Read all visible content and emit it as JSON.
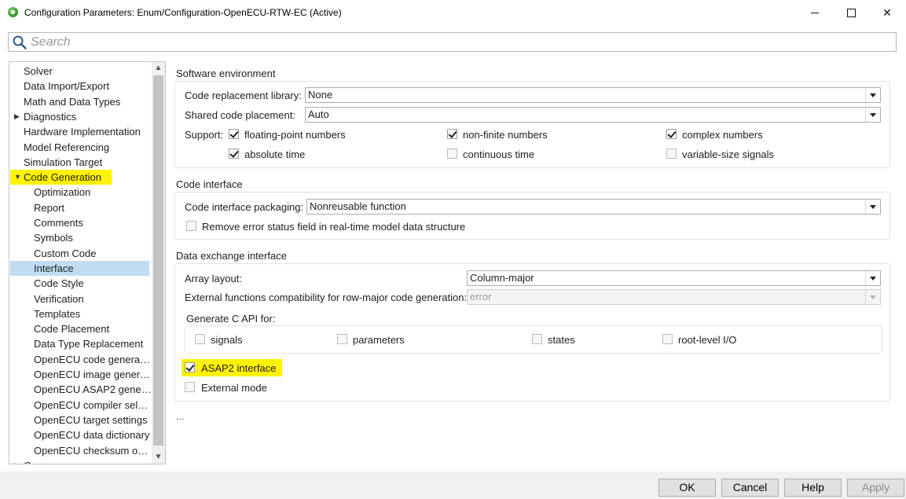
{
  "window": {
    "title": "Configuration Parameters: Enum/Configuration-OpenECU-RTW-EC (Active)",
    "minimize_glyph": "—",
    "close_glyph": "✕"
  },
  "search": {
    "placeholder": "Search",
    "value": ""
  },
  "tree": {
    "items": [
      {
        "label": "Solver",
        "level": 0
      },
      {
        "label": "Data Import/Export",
        "level": 0
      },
      {
        "label": "Math and Data Types",
        "level": 0
      },
      {
        "label": "Diagnostics",
        "level": 0,
        "expander": "collapsed"
      },
      {
        "label": "Hardware Implementation",
        "level": 0
      },
      {
        "label": "Model Referencing",
        "level": 0
      },
      {
        "label": "Simulation Target",
        "level": 0
      },
      {
        "label": "Code Generation",
        "level": 0,
        "expander": "expanded",
        "highlighted": true
      },
      {
        "label": "Optimization",
        "level": 1
      },
      {
        "label": "Report",
        "level": 1
      },
      {
        "label": "Comments",
        "level": 1
      },
      {
        "label": "Symbols",
        "level": 1
      },
      {
        "label": "Custom Code",
        "level": 1
      },
      {
        "label": "Interface",
        "level": 1,
        "selected": true
      },
      {
        "label": "Code Style",
        "level": 1
      },
      {
        "label": "Verification",
        "level": 1
      },
      {
        "label": "Templates",
        "level": 1
      },
      {
        "label": "Code Placement",
        "level": 1
      },
      {
        "label": "Data Type Replacement",
        "level": 1
      },
      {
        "label": "OpenECU code genera…",
        "level": 1
      },
      {
        "label": "OpenECU image gener…",
        "level": 1
      },
      {
        "label": "OpenECU ASAP2 gene…",
        "level": 1
      },
      {
        "label": "OpenECU compiler sel…",
        "level": 1
      },
      {
        "label": "OpenECU target settings",
        "level": 1
      },
      {
        "label": "OpenECU data dictionary",
        "level": 1
      },
      {
        "label": "OpenECU checksum o…",
        "level": 1
      },
      {
        "label": "Coverage",
        "level": 0,
        "expander": "collapsed"
      }
    ]
  },
  "software_env": {
    "title": "Software environment",
    "code_replacement_label": "Code replacement library:",
    "code_replacement_value": "None",
    "shared_code_label": "Shared code placement:",
    "shared_code_value": "Auto",
    "support_label": "Support:",
    "floating_point": {
      "label": "floating-point numbers",
      "checked": true
    },
    "non_finite": {
      "label": "non-finite numbers",
      "checked": true
    },
    "complex": {
      "label": "complex numbers",
      "checked": true
    },
    "absolute_time": {
      "label": "absolute time",
      "checked": true
    },
    "continuous_time": {
      "label": "continuous time",
      "checked": false
    },
    "variable_size": {
      "label": "variable-size signals",
      "checked": false
    }
  },
  "code_interface": {
    "title": "Code interface",
    "packaging_label": "Code interface packaging:",
    "packaging_value": "Nonreusable function",
    "remove_error": {
      "label": "Remove error status field in real-time model data structure",
      "checked": false
    }
  },
  "data_exchange": {
    "title": "Data exchange interface",
    "array_layout_label": "Array layout:",
    "array_layout_value": "Column-major",
    "ext_func_label": "External functions compatibility for row-major code generation:",
    "ext_func_value": "error",
    "c_api_label": "Generate C API for:",
    "signals": {
      "label": "signals",
      "checked": false
    },
    "parameters": {
      "label": "parameters",
      "checked": false
    },
    "states": {
      "label": "states",
      "checked": false
    },
    "root_io": {
      "label": "root-level I/O",
      "checked": false
    },
    "asap2": {
      "label": "ASAP2 interface",
      "checked": true,
      "highlighted": true
    },
    "external_mode": {
      "label": "External mode",
      "checked": false
    }
  },
  "more_ellipsis": "...",
  "highlight_color": "#fff200",
  "selection_color": "#bfdcf3",
  "buttons": {
    "ok": "OK",
    "cancel": "Cancel",
    "help": "Help",
    "apply": "Apply"
  }
}
